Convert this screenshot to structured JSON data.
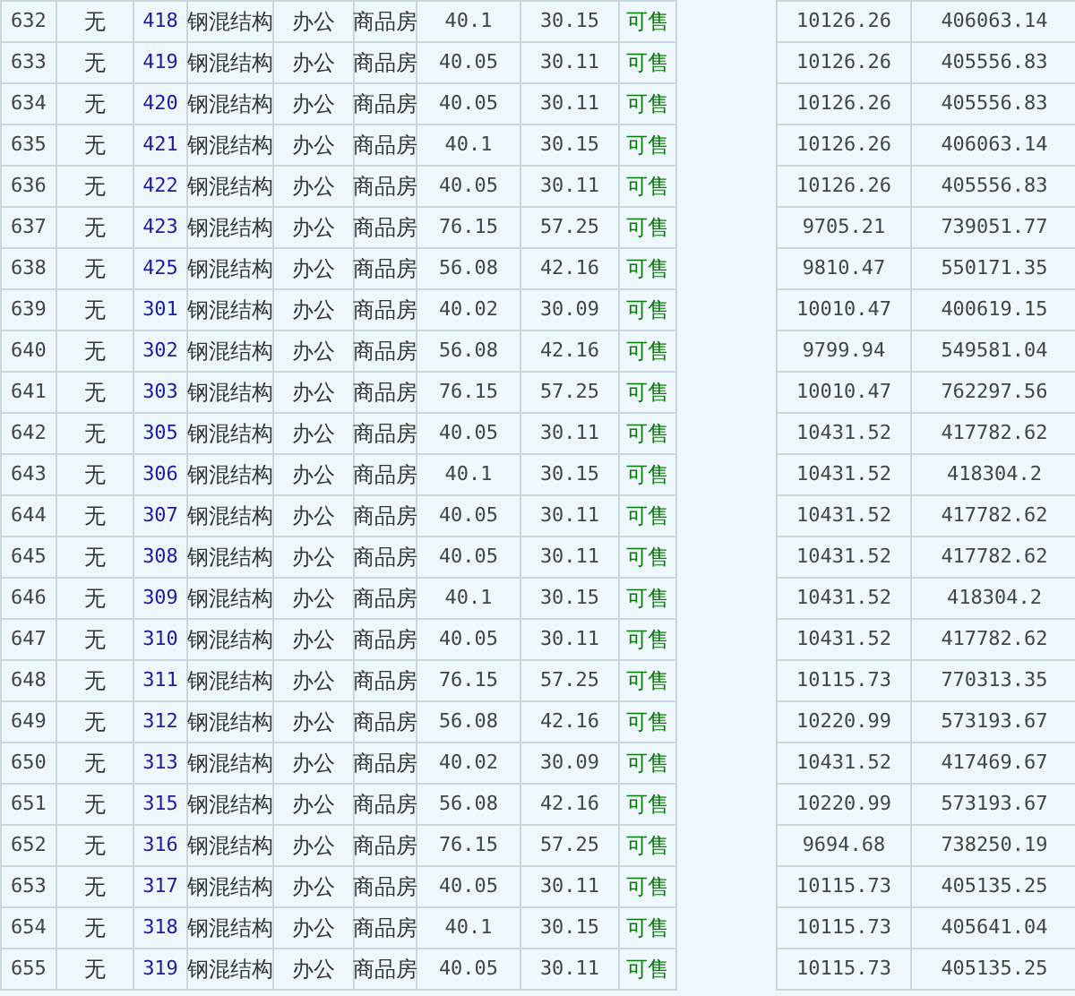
{
  "rows": [
    {
      "column_1": "632",
      "column_2": "无",
      "column_3": "418",
      "column_4": "钢混结构",
      "column_5": "办公",
      "column_6": "商品房",
      "column_7": "40.1",
      "column_8": "30.15",
      "column_9": "可售",
      "column_11": "10126.26",
      "column_12": "406063.14"
    },
    {
      "column_1": "633",
      "column_2": "无",
      "column_3": "419",
      "column_4": "钢混结构",
      "column_5": "办公",
      "column_6": "商品房",
      "column_7": "40.05",
      "column_8": "30.11",
      "column_9": "可售",
      "column_11": "10126.26",
      "column_12": "405556.83"
    },
    {
      "column_1": "634",
      "column_2": "无",
      "column_3": "420",
      "column_4": "钢混结构",
      "column_5": "办公",
      "column_6": "商品房",
      "column_7": "40.05",
      "column_8": "30.11",
      "column_9": "可售",
      "column_11": "10126.26",
      "column_12": "405556.83"
    },
    {
      "column_1": "635",
      "column_2": "无",
      "column_3": "421",
      "column_4": "钢混结构",
      "column_5": "办公",
      "column_6": "商品房",
      "column_7": "40.1",
      "column_8": "30.15",
      "column_9": "可售",
      "column_11": "10126.26",
      "column_12": "406063.14"
    },
    {
      "column_1": "636",
      "column_2": "无",
      "column_3": "422",
      "column_4": "钢混结构",
      "column_5": "办公",
      "column_6": "商品房",
      "column_7": "40.05",
      "column_8": "30.11",
      "column_9": "可售",
      "column_11": "10126.26",
      "column_12": "405556.83"
    },
    {
      "column_1": "637",
      "column_2": "无",
      "column_3": "423",
      "column_4": "钢混结构",
      "column_5": "办公",
      "column_6": "商品房",
      "column_7": "76.15",
      "column_8": "57.25",
      "column_9": "可售",
      "column_11": "9705.21",
      "column_12": "739051.77"
    },
    {
      "column_1": "638",
      "column_2": "无",
      "column_3": "425",
      "column_4": "钢混结构",
      "column_5": "办公",
      "column_6": "商品房",
      "column_7": "56.08",
      "column_8": "42.16",
      "column_9": "可售",
      "column_11": "9810.47",
      "column_12": "550171.35"
    },
    {
      "column_1": "639",
      "column_2": "无",
      "column_3": "301",
      "column_4": "钢混结构",
      "column_5": "办公",
      "column_6": "商品房",
      "column_7": "40.02",
      "column_8": "30.09",
      "column_9": "可售",
      "column_11": "10010.47",
      "column_12": "400619.15"
    },
    {
      "column_1": "640",
      "column_2": "无",
      "column_3": "302",
      "column_4": "钢混结构",
      "column_5": "办公",
      "column_6": "商品房",
      "column_7": "56.08",
      "column_8": "42.16",
      "column_9": "可售",
      "column_11": "9799.94",
      "column_12": "549581.04"
    },
    {
      "column_1": "641",
      "column_2": "无",
      "column_3": "303",
      "column_4": "钢混结构",
      "column_5": "办公",
      "column_6": "商品房",
      "column_7": "76.15",
      "column_8": "57.25",
      "column_9": "可售",
      "column_11": "10010.47",
      "column_12": "762297.56"
    },
    {
      "column_1": "642",
      "column_2": "无",
      "column_3": "305",
      "column_4": "钢混结构",
      "column_5": "办公",
      "column_6": "商品房",
      "column_7": "40.05",
      "column_8": "30.11",
      "column_9": "可售",
      "column_11": "10431.52",
      "column_12": "417782.62"
    },
    {
      "column_1": "643",
      "column_2": "无",
      "column_3": "306",
      "column_4": "钢混结构",
      "column_5": "办公",
      "column_6": "商品房",
      "column_7": "40.1",
      "column_8": "30.15",
      "column_9": "可售",
      "column_11": "10431.52",
      "column_12": "418304.2"
    },
    {
      "column_1": "644",
      "column_2": "无",
      "column_3": "307",
      "column_4": "钢混结构",
      "column_5": "办公",
      "column_6": "商品房",
      "column_7": "40.05",
      "column_8": "30.11",
      "column_9": "可售",
      "column_11": "10431.52",
      "column_12": "417782.62"
    },
    {
      "column_1": "645",
      "column_2": "无",
      "column_3": "308",
      "column_4": "钢混结构",
      "column_5": "办公",
      "column_6": "商品房",
      "column_7": "40.05",
      "column_8": "30.11",
      "column_9": "可售",
      "column_11": "10431.52",
      "column_12": "417782.62"
    },
    {
      "column_1": "646",
      "column_2": "无",
      "column_3": "309",
      "column_4": "钢混结构",
      "column_5": "办公",
      "column_6": "商品房",
      "column_7": "40.1",
      "column_8": "30.15",
      "column_9": "可售",
      "column_11": "10431.52",
      "column_12": "418304.2"
    },
    {
      "column_1": "647",
      "column_2": "无",
      "column_3": "310",
      "column_4": "钢混结构",
      "column_5": "办公",
      "column_6": "商品房",
      "column_7": "40.05",
      "column_8": "30.11",
      "column_9": "可售",
      "column_11": "10431.52",
      "column_12": "417782.62"
    },
    {
      "column_1": "648",
      "column_2": "无",
      "column_3": "311",
      "column_4": "钢混结构",
      "column_5": "办公",
      "column_6": "商品房",
      "column_7": "76.15",
      "column_8": "57.25",
      "column_9": "可售",
      "column_11": "10115.73",
      "column_12": "770313.35"
    },
    {
      "column_1": "649",
      "column_2": "无",
      "column_3": "312",
      "column_4": "钢混结构",
      "column_5": "办公",
      "column_6": "商品房",
      "column_7": "56.08",
      "column_8": "42.16",
      "column_9": "可售",
      "column_11": "10220.99",
      "column_12": "573193.67"
    },
    {
      "column_1": "650",
      "column_2": "无",
      "column_3": "313",
      "column_4": "钢混结构",
      "column_5": "办公",
      "column_6": "商品房",
      "column_7": "40.02",
      "column_8": "30.09",
      "column_9": "可售",
      "column_11": "10431.52",
      "column_12": "417469.67"
    },
    {
      "column_1": "651",
      "column_2": "无",
      "column_3": "315",
      "column_4": "钢混结构",
      "column_5": "办公",
      "column_6": "商品房",
      "column_7": "56.08",
      "column_8": "42.16",
      "column_9": "可售",
      "column_11": "10220.99",
      "column_12": "573193.67"
    },
    {
      "column_1": "652",
      "column_2": "无",
      "column_3": "316",
      "column_4": "钢混结构",
      "column_5": "办公",
      "column_6": "商品房",
      "column_7": "76.15",
      "column_8": "57.25",
      "column_9": "可售",
      "column_11": "9694.68",
      "column_12": "738250.19"
    },
    {
      "column_1": "653",
      "column_2": "无",
      "column_3": "317",
      "column_4": "钢混结构",
      "column_5": "办公",
      "column_6": "商品房",
      "column_7": "40.05",
      "column_8": "30.11",
      "column_9": "可售",
      "column_11": "10115.73",
      "column_12": "405135.25"
    },
    {
      "column_1": "654",
      "column_2": "无",
      "column_3": "318",
      "column_4": "钢混结构",
      "column_5": "办公",
      "column_6": "商品房",
      "column_7": "40.1",
      "column_8": "30.15",
      "column_9": "可售",
      "column_11": "10115.73",
      "column_12": "405641.04"
    },
    {
      "column_1": "655",
      "column_2": "无",
      "column_3": "319",
      "column_4": "钢混结构",
      "column_5": "办公",
      "column_6": "商品房",
      "column_7": "40.05",
      "column_8": "30.11",
      "column_9": "可售",
      "column_11": "10115.73",
      "column_12": "405135.25"
    }
  ]
}
